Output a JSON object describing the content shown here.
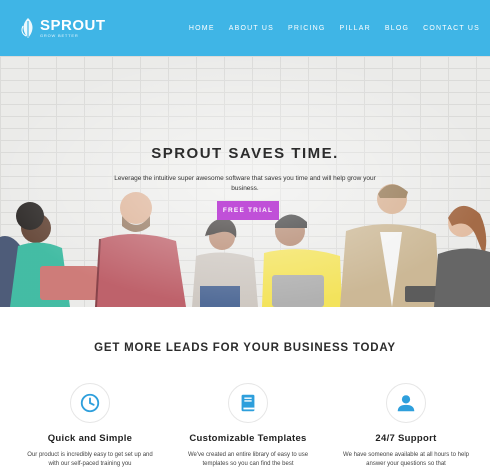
{
  "header": {
    "logo_title": "SPROUT",
    "logo_tagline": "GROW BETTER",
    "nav": [
      "HOME",
      "ABOUT US",
      "PRICING",
      "PILLAR",
      "BLOG",
      "CONTACT US"
    ]
  },
  "hero": {
    "title": "SPROUT SAVES TIME.",
    "text": "Leverage the intuitive super awesome software that saves you time and will help grow your business.",
    "button_label": "FREE TRIAL"
  },
  "leads": {
    "heading": "GET MORE LEADS FOR YOUR BUSINESS TODAY",
    "features": [
      {
        "icon": "clock-icon",
        "title": "Quick and Simple",
        "text": "Our product is incredibly easy to get set up and with our self-paced training you"
      },
      {
        "icon": "book-icon",
        "title": "Customizable Templates",
        "text": "We've created an entire library of easy to use templates so you can find the best"
      },
      {
        "icon": "user-icon",
        "title": "24/7 Support",
        "text": "We have someone available at all hours to help answer your questions so that"
      }
    ]
  },
  "colors": {
    "header_bg": "#3fb5e6",
    "accent": "#c050d8",
    "icon_blue": "#2e9fdc"
  }
}
